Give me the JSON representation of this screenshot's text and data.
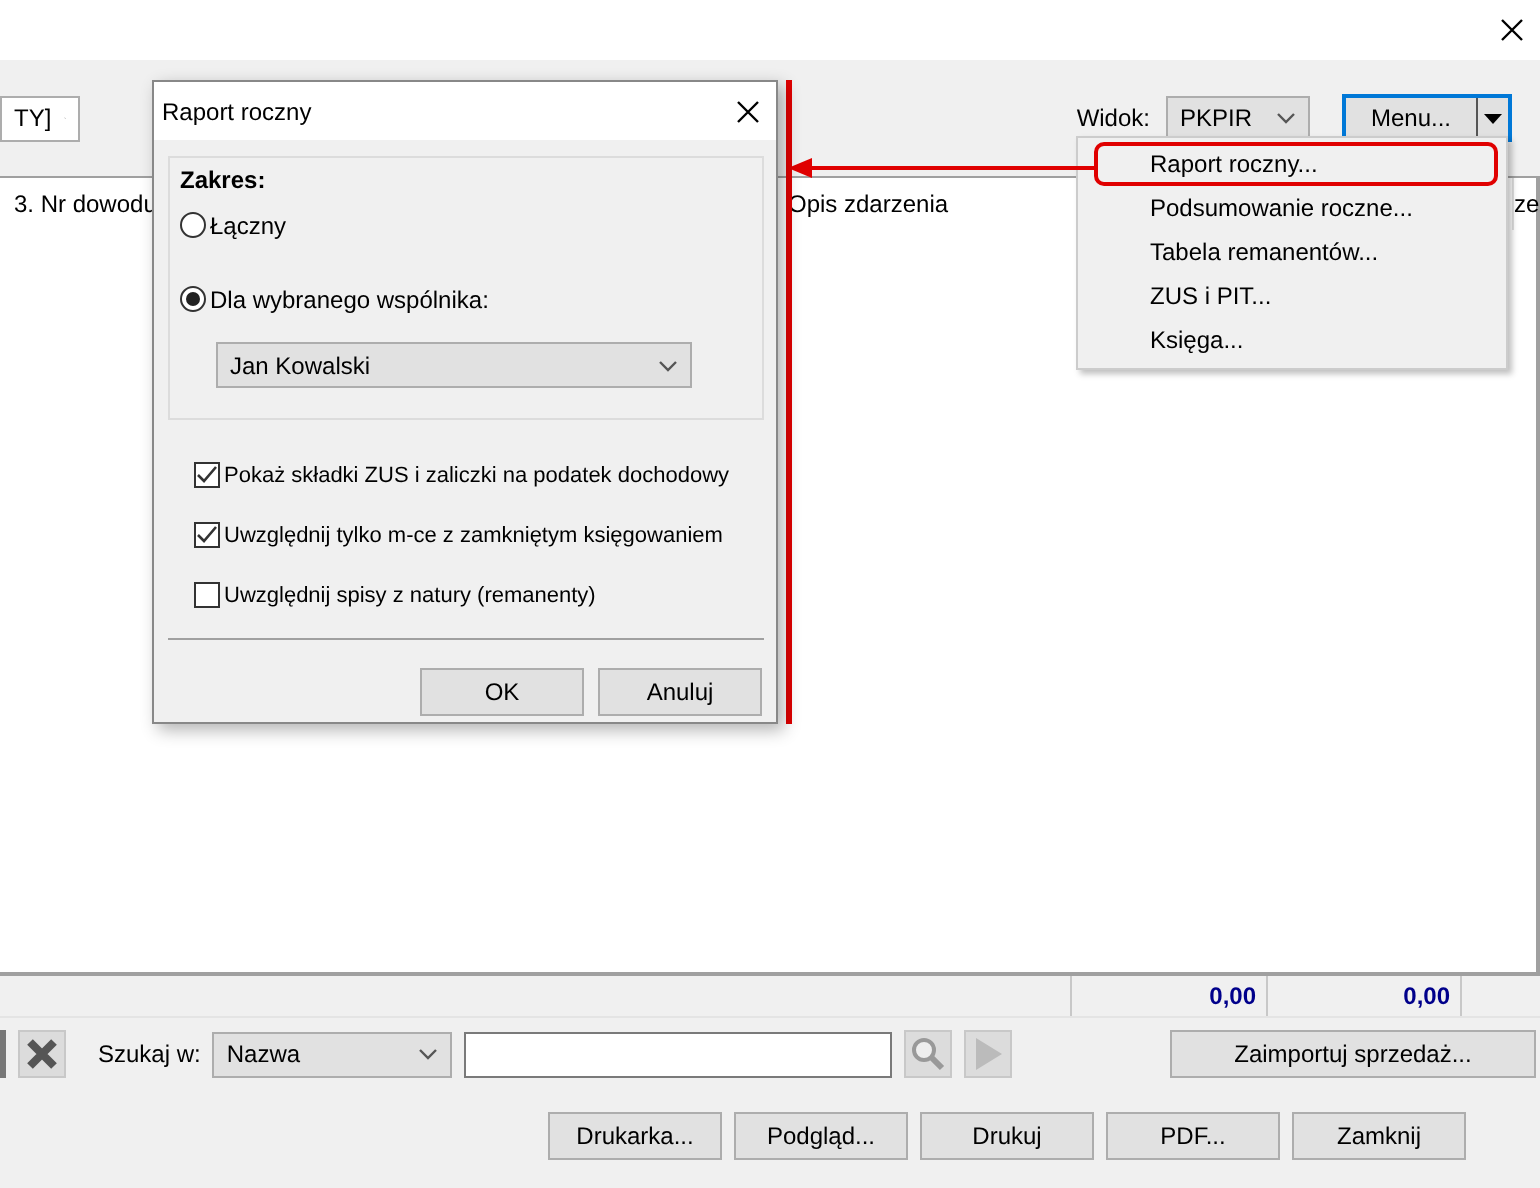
{
  "toolbar": {
    "filter_value": "TY]",
    "view_label": "Widok:",
    "view_value": "PKPIR",
    "menu_button": "Menu..."
  },
  "menu": {
    "items": [
      {
        "label": "Raport roczny...",
        "selected": true
      },
      {
        "label": "Podsumowanie roczne...",
        "selected": false
      },
      {
        "label": "Tabela remanentów...",
        "selected": false
      },
      {
        "label": "ZUS i PIT...",
        "selected": false
      },
      {
        "label": "Księga...",
        "selected": false
      }
    ]
  },
  "table": {
    "columns": [
      "3. Nr dowodu",
      "Opis zdarzenia",
      "ze"
    ],
    "totals": [
      "0,00",
      "0,00"
    ]
  },
  "search": {
    "label": "Szukaj w:",
    "field": "Nazwa",
    "import_button": "Zaimportuj sprzedaż..."
  },
  "buttons": [
    "Drukarka...",
    "Podgląd...",
    "Drukuj",
    "PDF...",
    "Zamknij"
  ],
  "dialog": {
    "title": "Raport roczny",
    "group_title": "Zakres:",
    "options": [
      {
        "label": "Łączny",
        "selected": false
      },
      {
        "label": "Dla wybranego wspólnika:",
        "selected": true
      }
    ],
    "partner": "Jan Kowalski",
    "checkboxes": [
      {
        "label": "Pokaż składki ZUS i zaliczki na podatek dochodowy",
        "checked": true
      },
      {
        "label": "Uwzględnij tylko m-ce z zamkniętym księgowaniem",
        "checked": true
      },
      {
        "label": "Uwzględnij spisy z natury (remanenty)",
        "checked": false
      }
    ],
    "buttons": [
      "OK",
      "Anuluj"
    ]
  }
}
